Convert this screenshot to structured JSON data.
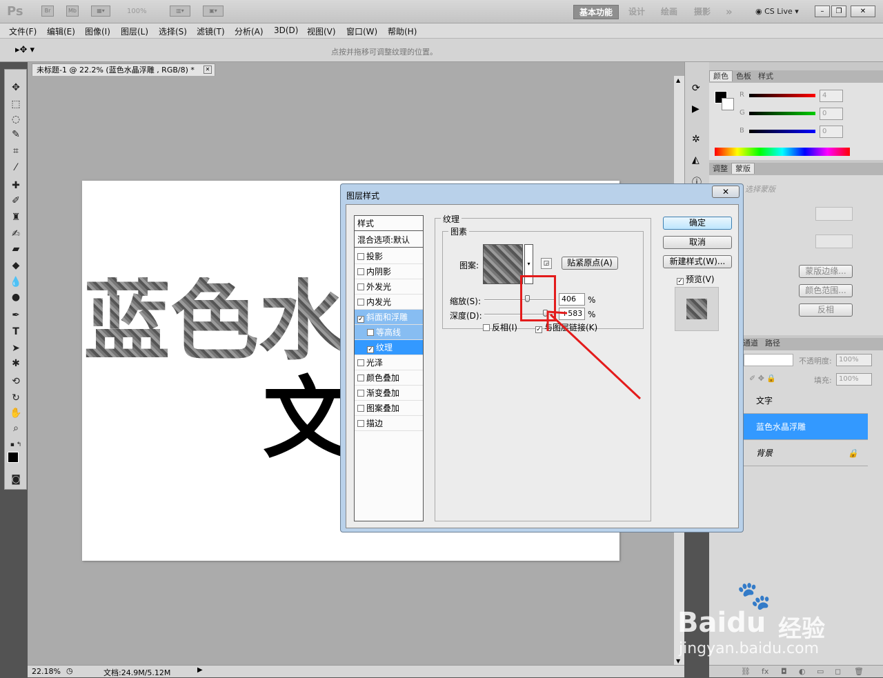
{
  "app": {
    "logo": "Ps",
    "br_label": "Br",
    "mb_label": "Mb",
    "zoom_display": "100%",
    "workspaces": [
      "基本功能",
      "设计",
      "绘画",
      "摄影"
    ],
    "more": "»",
    "cs_live": "CS Live",
    "win_controls": [
      "–",
      "❐",
      "✕"
    ]
  },
  "menu": [
    "文件(F)",
    "编辑(E)",
    "图像(I)",
    "图层(L)",
    "选择(S)",
    "滤镜(T)",
    "分析(A)",
    "3D(D)",
    "视图(V)",
    "窗口(W)",
    "帮助(H)"
  ],
  "options": {
    "hint": "点按并拖移可调整纹理的位置。"
  },
  "document": {
    "tab_title": "未标题-1 @ 22.2% (蓝色水晶浮雕 , RGB/8) *",
    "tab_close": "✕",
    "canvas_line1": [
      "蓝",
      "色",
      "水"
    ],
    "canvas_line2": "文"
  },
  "status": {
    "zoom": "22.18%",
    "doc_size": "文档:24.9M/5.12M"
  },
  "color_panel": {
    "tabs": [
      "颜色",
      "色板",
      "样式"
    ],
    "channels": [
      {
        "label": "R",
        "value": "4"
      },
      {
        "label": "G",
        "value": "0"
      },
      {
        "label": "B",
        "value": "0"
      }
    ]
  },
  "adjust_panel": {
    "tabs": [
      "调整",
      "蒙版"
    ],
    "subtitle": "选择蒙版",
    "buttons": [
      "蒙版边缘...",
      "颜色范围...",
      "反相"
    ]
  },
  "layers_panel": {
    "tabs": [
      "通道",
      "路径"
    ],
    "opacity_label": "不透明度:",
    "opacity_value": "100%",
    "fill_label": "填充:",
    "fill_value": "100%",
    "layers": [
      {
        "name": "文字",
        "selected": false
      },
      {
        "name": "蓝色水晶浮雕",
        "selected": true
      },
      {
        "name": "背景",
        "selected": false
      }
    ]
  },
  "dialog": {
    "title": "图层样式",
    "close": "✕",
    "styles_header": "样式",
    "blend_options": "混合选项:默认",
    "styles": [
      {
        "label": "投影",
        "checked": false,
        "sub": false,
        "selected": false
      },
      {
        "label": "内阴影",
        "checked": false,
        "sub": false,
        "selected": false
      },
      {
        "label": "外发光",
        "checked": false,
        "sub": false,
        "selected": false
      },
      {
        "label": "内发光",
        "checked": false,
        "sub": false,
        "selected": false
      },
      {
        "label": "斜面和浮雕",
        "checked": true,
        "sub": false,
        "selected": "light"
      },
      {
        "label": "等高线",
        "checked": false,
        "sub": true,
        "selected": "light"
      },
      {
        "label": "纹理",
        "checked": true,
        "sub": true,
        "selected": true
      },
      {
        "label": "光泽",
        "checked": false,
        "sub": false,
        "selected": false
      },
      {
        "label": "颜色叠加",
        "checked": false,
        "sub": false,
        "selected": false
      },
      {
        "label": "渐变叠加",
        "checked": false,
        "sub": false,
        "selected": false
      },
      {
        "label": "图案叠加",
        "checked": false,
        "sub": false,
        "selected": false
      },
      {
        "label": "描边",
        "checked": false,
        "sub": false,
        "selected": false
      }
    ],
    "section_title": "纹理",
    "group_title": "图素",
    "pattern_label": "图案:",
    "snap_button": "贴紧原点(A)",
    "scale_label": "缩放(S):",
    "scale_value": "406",
    "depth_label": "深度(D):",
    "depth_value": "+583",
    "percent": "%",
    "invert_label": "反相(I)",
    "invert_checked": false,
    "link_label": "与图层链接(K)",
    "link_checked": true,
    "ok": "确定",
    "cancel": "取消",
    "new_style": "新建样式(W)...",
    "preview_label": "预览(V)",
    "preview_checked": true
  },
  "watermark": {
    "brand": "Bai",
    "brand2": "du",
    "jingyan": "经验",
    "url": "jingyan.baidu.com"
  }
}
